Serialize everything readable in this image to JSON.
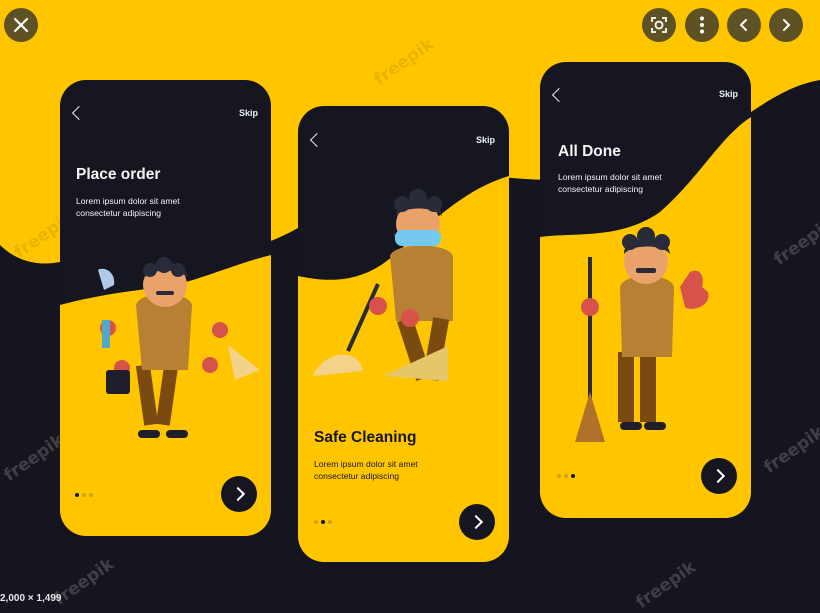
{
  "screens": [
    {
      "title": "Place order",
      "desc": "Lorem ipsum dolor sit amet consectetur adipiscing",
      "skip": "Skip",
      "active_dot": 0
    },
    {
      "title": "Safe Cleaning",
      "desc": "Lorem ipsum dolor sit amet consectetur adipiscing",
      "skip": "Skip",
      "active_dot": 1
    },
    {
      "title": "All Done",
      "desc": "Lorem ipsum dolor sit amet consectetur adipiscing",
      "skip": "Skip",
      "active_dot": 2
    }
  ],
  "watermark": "freepik",
  "image_dimensions": "2,000 × 1,499",
  "viewer_controls": [
    "close-icon",
    "visual-search-icon",
    "more-options-icon",
    "previous-icon",
    "next-icon"
  ],
  "colors": {
    "yellow": "#ffc600",
    "dark": "#15161f"
  }
}
